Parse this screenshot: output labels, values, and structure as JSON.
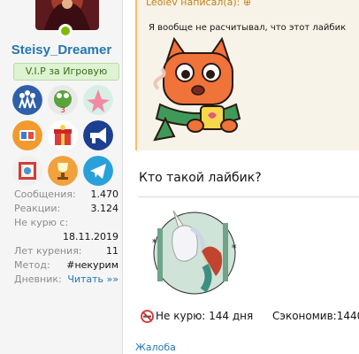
{
  "user": {
    "username": "Steisy_Dreamer",
    "badge": "V.I.P за Игровую",
    "online": true,
    "stats": [
      {
        "label": "Сообщения:",
        "value": "1.470"
      },
      {
        "label": "Реакции:",
        "value": "3.124"
      },
      {
        "label": "Не курю с:",
        "value": ""
      },
      {
        "label": "",
        "value": "18.11.2019"
      },
      {
        "label": "Лет курения:",
        "value": "11"
      },
      {
        "label": "Метод:",
        "value": "#некурим"
      },
      {
        "label": "Дневник:",
        "value": "Читать »»"
      }
    ],
    "awards": [
      "people-award-icon",
      "frog-award-icon",
      "patrick-award-icon",
      "books-award-icon",
      "gift-award-icon",
      "megaphone-award-icon",
      "frame-award-icon",
      "trophy-award-icon",
      "telegram-award-icon"
    ]
  },
  "post": {
    "quote": {
      "author": "Leolev написал(а): ⊕",
      "text": "Я вообще не расчитывал, что этот лайбик"
    },
    "question": "Кто такой лайбик?",
    "signature": {
      "noquit_label": "Не курю: 144 дня",
      "saved_label": "Сэкономив:1440"
    },
    "report": "Жалоба"
  },
  "colors": {
    "link": "#2577b1",
    "quote_border": "#f9bc6d",
    "badge_bg": "#ddf3d2"
  }
}
